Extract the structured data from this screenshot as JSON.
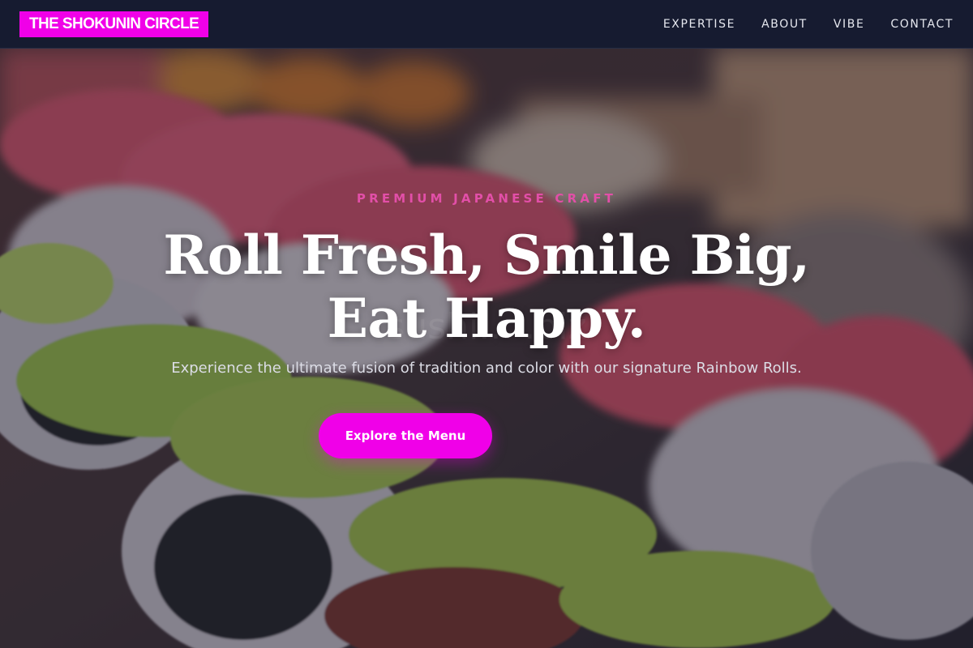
{
  "header": {
    "brand": "THE SHOKUNIN CIRCLE",
    "nav": [
      {
        "label": "EXPERTISE"
      },
      {
        "label": "ABOUT"
      },
      {
        "label": "VIBE"
      },
      {
        "label": "CONTACT"
      }
    ]
  },
  "hero": {
    "kicker": "PREMIUM JAPANESE CRAFT",
    "headline": "Roll Fresh, Smile Big, Eat Happy.",
    "subtitle": "Experience the ultimate fusion of tradition and color with our signature Rainbow Rolls.",
    "cta_label": "Explore the Menu",
    "watermark": "sushi... .biz",
    "background_image": "rainbow-sushi-rolls-photo"
  },
  "colors": {
    "brand_accent": "#f000e8",
    "kicker": "#e24fa8",
    "navbar_bg": "#161b30"
  }
}
